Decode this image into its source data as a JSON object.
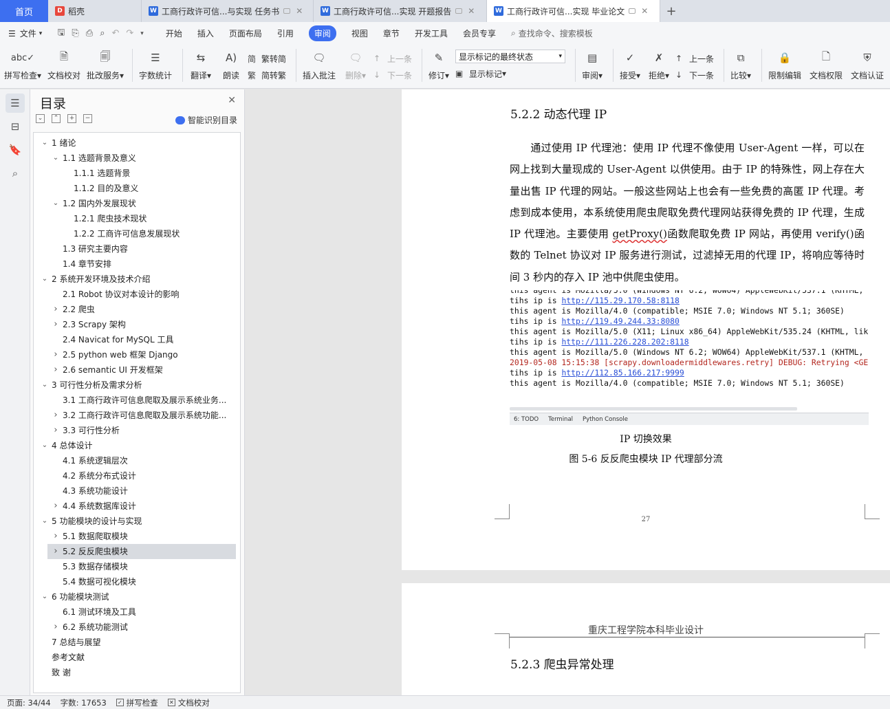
{
  "tabs": {
    "home": "首页",
    "items": [
      {
        "label": "稻壳",
        "icon": "docer-icon"
      },
      {
        "label": "工商行政许可信...与实现 任务书",
        "icon": "wps-writer-icon"
      },
      {
        "label": "工商行政许可信...实现 开题报告",
        "icon": "wps-writer-icon"
      },
      {
        "label": "工商行政许可信...实现 毕业论文",
        "icon": "wps-writer-icon",
        "active": true
      }
    ]
  },
  "menu": {
    "file": "文件",
    "items": [
      "开始",
      "插入",
      "页面布局",
      "引用",
      "审阅",
      "视图",
      "章节",
      "开发工具",
      "会员专享"
    ],
    "active": "审阅",
    "search": "查找命令、搜索模板"
  },
  "ribbon": {
    "spell": "拼写检查",
    "doc_check": "文档校对",
    "correction": "批改服务",
    "word_count": "字数统计",
    "translate": "翻译",
    "read_aloud": "朗读",
    "trad_to_simp": "繁转简",
    "simp_to_trad": "简转繁",
    "insert_comment": "插入批注",
    "delete": "删除",
    "prev_comment": "上一条",
    "next_comment": "下一条",
    "revise": "修订",
    "markup_select": "显示标记的最终状态",
    "show_markup": "显示标记",
    "review": "审阅",
    "accept": "接受",
    "reject": "拒绝",
    "prev": "上一条",
    "next": "下一条",
    "compare": "比较",
    "restrict_edit": "限制编辑",
    "doc_rights": "文档权限",
    "doc_cert": "文档认证"
  },
  "toc": {
    "title": "目录",
    "smart": "智能识别目录",
    "items": [
      {
        "text": "1  绪论",
        "level": 0,
        "arrow": "v"
      },
      {
        "text": "1.1  选题背景及意义",
        "level": 1,
        "arrow": "v"
      },
      {
        "text": "1.1.1 选题背景",
        "level": 2,
        "arrow": ""
      },
      {
        "text": "1.1.2 目的及意义",
        "level": 2,
        "arrow": ""
      },
      {
        "text": "1.2  国内外发展现状",
        "level": 1,
        "arrow": "v"
      },
      {
        "text": "1.2.1   爬虫技术现状",
        "level": 2,
        "arrow": ""
      },
      {
        "text": "1.2.2   工商许可信息发展现状",
        "level": 2,
        "arrow": ""
      },
      {
        "text": "1.3  研究主要内容",
        "level": 1,
        "arrow": ""
      },
      {
        "text": "1.4  章节安排",
        "level": 1,
        "arrow": ""
      },
      {
        "text": "2  系统开发环境及技术介绍",
        "level": 0,
        "arrow": "v"
      },
      {
        "text": "2.1 Robot 协议对本设计的影响",
        "level": 1,
        "arrow": ""
      },
      {
        "text": "2.2  爬虫",
        "level": 1,
        "arrow": ">"
      },
      {
        "text": "2.3 Scrapy 架构",
        "level": 1,
        "arrow": ">"
      },
      {
        "text": "2.4 Navicat for MySQL 工具",
        "level": 1,
        "arrow": ""
      },
      {
        "text": "2.5 python web 框架 Django",
        "level": 1,
        "arrow": ">"
      },
      {
        "text": "2.6 semantic UI 开发框架",
        "level": 1,
        "arrow": ">"
      },
      {
        "text": "3  可行性分析及需求分析",
        "level": 0,
        "arrow": "v"
      },
      {
        "text": "3.1  工商行政许可信息爬取及展示系统业务...",
        "level": 1,
        "arrow": ""
      },
      {
        "text": "3.2  工商行政许可信息爬取及展示系统功能...",
        "level": 1,
        "arrow": ">"
      },
      {
        "text": "3.3  可行性分析",
        "level": 1,
        "arrow": ">"
      },
      {
        "text": "4  总体设计",
        "level": 0,
        "arrow": "v"
      },
      {
        "text": "4.1  系统逻辑层次",
        "level": 1,
        "arrow": ""
      },
      {
        "text": "4.2  系统分布式设计",
        "level": 1,
        "arrow": ""
      },
      {
        "text": "4.3  系统功能设计",
        "level": 1,
        "arrow": ""
      },
      {
        "text": "4.4  系统数据库设计",
        "level": 1,
        "arrow": ">"
      },
      {
        "text": "5  功能模块的设计与实现",
        "level": 0,
        "arrow": "v"
      },
      {
        "text": "5.1  数据爬取模块",
        "level": 1,
        "arrow": ">"
      },
      {
        "text": "5.2  反反爬虫模块",
        "level": 1,
        "arrow": ">",
        "selected": true
      },
      {
        "text": "5.3  数据存储模块",
        "level": 1,
        "arrow": ""
      },
      {
        "text": "5.4  数据可视化模块",
        "level": 1,
        "arrow": ""
      },
      {
        "text": "6  功能模块测试",
        "level": 0,
        "arrow": "v"
      },
      {
        "text": "6.1  测试环境及工具",
        "level": 1,
        "arrow": ""
      },
      {
        "text": "6.2  系统功能测试",
        "level": 1,
        "arrow": ">"
      },
      {
        "text": "7 总结与展望",
        "level": 0,
        "arrow": ""
      },
      {
        "text": "参考文献",
        "level": 0,
        "arrow": ""
      },
      {
        "text": "致   谢",
        "level": 0,
        "arrow": ""
      }
    ]
  },
  "document": {
    "heading_522": "5.2.2  动态代理 IP",
    "para_1": "通过使用 IP 代理池：使用 IP 代理不像使用 User-Agent 一样，可以在网上找到大量现成的 User-Agent 以供使用。由于 IP 的特殊性，网上存在大量出售 IP 代理的网站。一般这些网站上也会有一些免费的高匿 IP 代理。考虑到成本使用，本系统使用爬虫爬取免费代理网站获得免费的 IP 代理，生成 IP 代理池。主要使用 ",
    "para_fn1": "getProxy()",
    "para_2": "函数爬取免费 IP 网站，再使用 verify()函数的 Telnet 协议对 IP 服务进行测试，过滤掉无用的代理 IP，将响应等待时间 3 秒内的存入 IP 池中供爬虫使用。",
    "console": [
      {
        "pre": "this agent is Mozilla/5.0 (Windows NT 6.2; WOW64) AppleWebKit/537.1 (KHTML,",
        "link": "",
        "post": "",
        "err": false
      },
      {
        "pre": "tihs ip is ",
        "link": "http://115.29.170.58:8118",
        "post": "",
        "err": false
      },
      {
        "pre": "this agent is Mozilla/4.0 (compatible; MSIE 7.0; Windows NT 5.1; 360SE)",
        "link": "",
        "post": "",
        "err": false
      },
      {
        "pre": "tihs ip is ",
        "link": "http://119.49.244.33:8080",
        "post": "",
        "err": false
      },
      {
        "pre": "this agent is Mozilla/5.0 (X11; Linux x86_64) AppleWebKit/535.24 (KHTML, lik",
        "link": "",
        "post": "",
        "err": false
      },
      {
        "pre": "tihs ip is ",
        "link": "http://111.226.228.202:8118",
        "post": "",
        "err": false
      },
      {
        "pre": "this agent is Mozilla/5.0 (Windows NT 6.2; WOW64) AppleWebKit/537.1 (KHTML,",
        "link": "",
        "post": "",
        "err": false
      },
      {
        "pre": "2019-05-08 15:15:38 [scrapy.downloadermiddlewares.retry] DEBUG: Retrying <GE",
        "link": "",
        "post": "",
        "err": true
      },
      {
        "pre": "tihs ip is ",
        "link": "http://112.85.166.217:9999",
        "post": "",
        "err": false
      },
      {
        "pre": "this agent is Mozilla/4.0 (compatible; MSIE 7.0; Windows NT 5.1; 360SE)",
        "link": "",
        "post": "",
        "err": false
      }
    ],
    "console_tabs": [
      "6: TODO",
      "Terminal",
      "Python Console"
    ],
    "caption_1": "IP 切换效果",
    "caption_2": "图 5-6  反反爬虫模块 IP 代理部分流",
    "page_number": "27",
    "page2_header": "重庆工程学院本科毕业设计",
    "heading_523": "5.2.3  爬虫异常处理"
  },
  "status": {
    "page": "页面: 34/44",
    "words": "字数: 17653",
    "spell": "拼写检查",
    "doc_check": "文档校对"
  }
}
